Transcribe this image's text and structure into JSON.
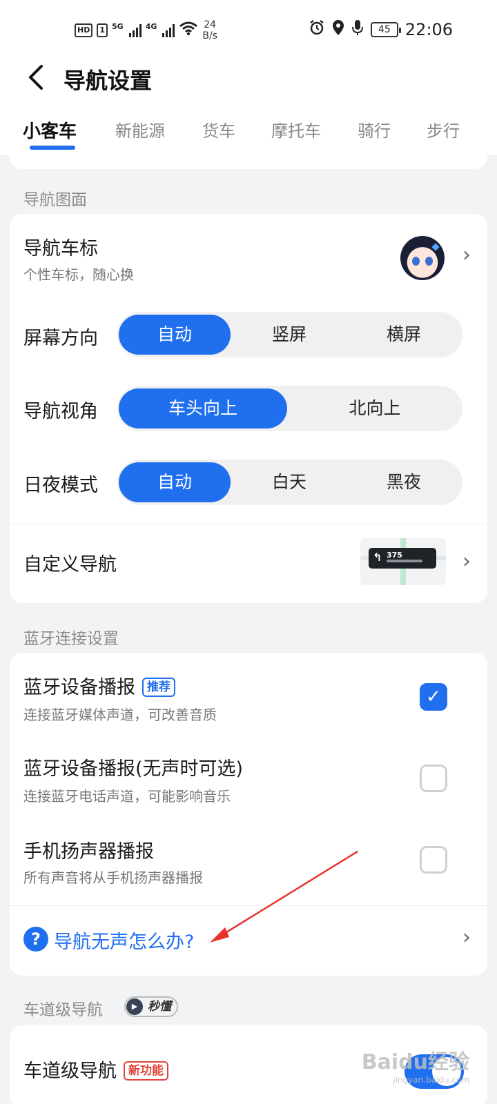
{
  "status_bar": {
    "hd": "HD",
    "sim1": "1",
    "net1": "5G",
    "net2": "4G",
    "speed_value": "24",
    "speed_unit": "B/s",
    "battery": "45",
    "time": "22:06"
  },
  "header": {
    "back_icon": "chevron-left-icon",
    "title": "导航设置",
    "tabs": [
      "小客车",
      "新能源",
      "货车",
      "摩托车",
      "骑行",
      "步行"
    ],
    "active_tab": "小客车"
  },
  "section_display": {
    "title": "导航图面",
    "vehicle_icon": {
      "title": "导航车标",
      "subtitle": "个性车标，随心换"
    },
    "screen_orientation": {
      "label": "屏幕方向",
      "options": [
        "自动",
        "竖屏",
        "横屏"
      ],
      "selected": "自动"
    },
    "view_angle": {
      "label": "导航视角",
      "options": [
        "车头向上",
        "北向上"
      ],
      "selected": "车头向上"
    },
    "day_night": {
      "label": "日夜模式",
      "options": [
        "自动",
        "白天",
        "黑夜"
      ],
      "selected": "自动"
    },
    "custom_nav": {
      "label": "自定义导航",
      "thumb_distance": "375"
    }
  },
  "section_bluetooth": {
    "title": "蓝牙连接设置",
    "items": [
      {
        "title": "蓝牙设备播报",
        "badge": "推荐",
        "subtitle": "连接蓝牙媒体声道，可改善音质",
        "checked": true
      },
      {
        "title": "蓝牙设备播报(无声时可选)",
        "subtitle": "连接蓝牙电话声道，可能影响音乐",
        "checked": false
      },
      {
        "title": "手机扬声器播报",
        "subtitle": "所有声音将从手机扬声器播报",
        "checked": false
      }
    ],
    "help_link": "导航无声怎么办?",
    "help_icon_glyph": "?"
  },
  "section_lane": {
    "title": "车道级导航",
    "video_badge": "秒懂",
    "item": {
      "title": "车道级导航",
      "badge": "新功能",
      "enabled": true
    }
  },
  "watermark": {
    "brand": "Baidu经验",
    "url": "jingyan.baidu.com"
  },
  "colors": {
    "accent": "#1f6fef",
    "new_badge": "#e0463c",
    "annotation_arrow": "#e8322b"
  }
}
